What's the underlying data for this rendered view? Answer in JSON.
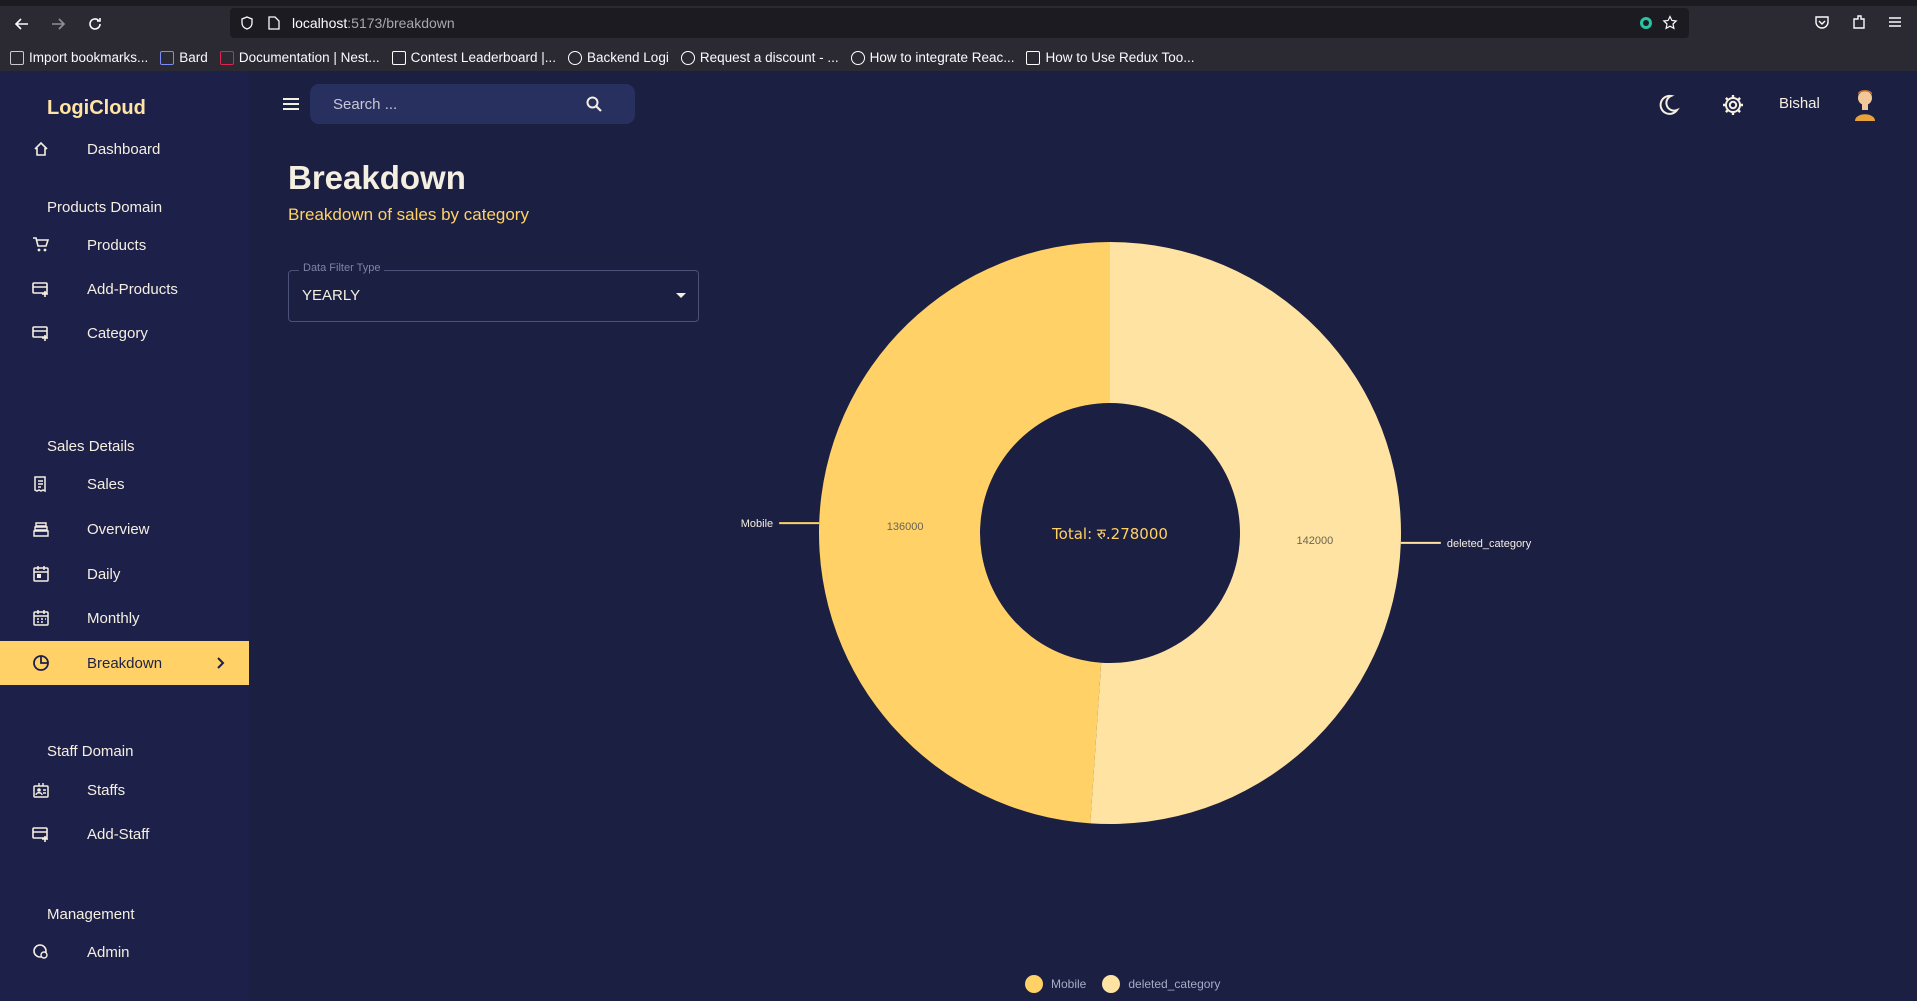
{
  "browser": {
    "url_host": "localhost",
    "url_path": ":5173/breakdown",
    "bookmarks": [
      {
        "label": "Import bookmarks...",
        "icon": "import-icon",
        "color": "#c9c9d1"
      },
      {
        "label": "Bard",
        "icon": "bard-icon",
        "color": "#7a8cf5"
      },
      {
        "label": "Documentation | Nest...",
        "icon": "nestjs-icon",
        "color": "#e0234e"
      },
      {
        "label": "Contest Leaderboard |...",
        "icon": "hackerrank-icon",
        "color": "#ffffff"
      },
      {
        "label": "Backend Logi",
        "icon": "github-icon",
        "color": "#ffffff"
      },
      {
        "label": "Request a discount - ...",
        "icon": "github-icon",
        "color": "#ffffff"
      },
      {
        "label": "How to integrate Reac...",
        "icon": "medium-icon",
        "color": "#ffffff"
      },
      {
        "label": "How to Use Redux Too...",
        "icon": "redux-icon",
        "color": "#ffffff"
      }
    ]
  },
  "sidebar": {
    "brand": "LogiCloud",
    "dashboard": "Dashboard",
    "sections": [
      {
        "title": "Products Domain",
        "items": [
          "Products",
          "Add-Products",
          "Category"
        ]
      },
      {
        "title": "Sales Details",
        "items": [
          "Sales",
          "Overview",
          "Daily",
          "Monthly",
          "Breakdown"
        ]
      },
      {
        "title": "Staff Domain",
        "items": [
          "Staffs",
          "Add-Staff"
        ]
      },
      {
        "title": "Management",
        "items": [
          "Admin"
        ]
      }
    ],
    "active_item": "Breakdown"
  },
  "header": {
    "search_placeholder": "Search ...",
    "username": "Bishal"
  },
  "page": {
    "title": "Breakdown",
    "subtitle": "Breakdown of sales by category",
    "filter_label": "Data Filter Type",
    "filter_value": "YEARLY"
  },
  "colors": {
    "accent": "#ffd166",
    "sidebar_bg": "#1d2149",
    "main_bg": "#1b1f42",
    "slice_mobile": "#ffd166",
    "slice_deleted": "#ffe3a3"
  },
  "chart_data": {
    "type": "pie",
    "variant": "donut",
    "categories": [
      "Mobile",
      "deleted_category"
    ],
    "values": [
      136000,
      142000
    ],
    "center_label": "Total: रु.278000",
    "legend": [
      "Mobile",
      "deleted_category"
    ],
    "legend_placement": "bottom"
  }
}
